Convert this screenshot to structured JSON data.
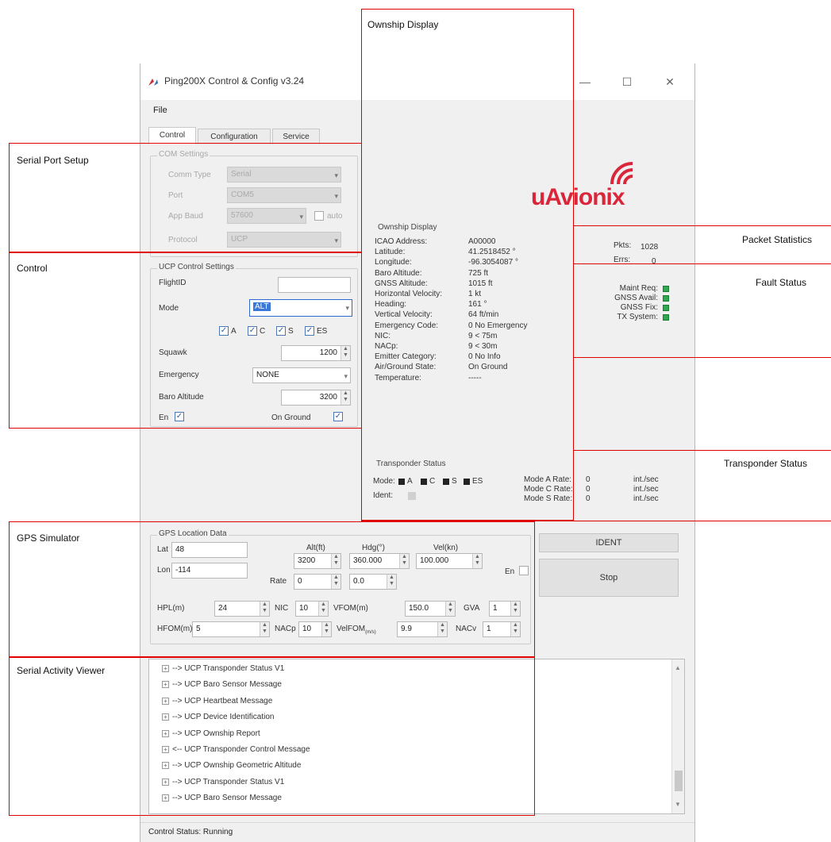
{
  "window": {
    "title": "Ping200X Control & Config v3.24",
    "minimize": "—",
    "maximize": "☐",
    "close": "✕",
    "menu_file": "File",
    "tabs": [
      "Control",
      "Configuration",
      "Service"
    ],
    "status_bar": "Control Status:  Running"
  },
  "com_settings": {
    "title": "COM Settings",
    "comm_type_label": "Comm Type",
    "comm_type_value": "Serial",
    "port_label": "Port",
    "port_value": "COM5",
    "app_baud_label": "App Baud",
    "app_baud_value": "57600",
    "auto_label": "auto",
    "protocol_label": "Protocol",
    "protocol_value": "UCP"
  },
  "ucp_control": {
    "title": "UCP Control Settings",
    "flight_id_label": "FlightID",
    "flight_id_value": "",
    "mode_label": "Mode",
    "mode_value": "ALT",
    "mode_checks": [
      "A",
      "C",
      "S",
      "ES"
    ],
    "squawk_label": "Squawk",
    "squawk_value": "1200",
    "emergency_label": "Emergency",
    "emergency_value": "NONE",
    "baro_label": "Baro Altitude",
    "baro_value": "3200",
    "en_label": "En",
    "on_ground_label": "On Ground"
  },
  "logo_text": "uAvionix",
  "ownship": {
    "title": "Ownship Display",
    "rows": [
      {
        "label": "ICAO Address:",
        "value": "A00000"
      },
      {
        "label": "Latitude:",
        "value": "41.2518452 °"
      },
      {
        "label": "Longitude:",
        "value": "-96.3054087 °"
      },
      {
        "label": "Baro Altitude:",
        "value": "725 ft"
      },
      {
        "label": "GNSS Altitude:",
        "value": "1015 ft"
      },
      {
        "label": "Horizontal Velocity:",
        "value": "1 kt"
      },
      {
        "label": "Heading:",
        "value": "161 °"
      },
      {
        "label": "Vertical Velocity:",
        "value": "64 ft/min"
      },
      {
        "label": "Emergency Code:",
        "value": "0   No Emergency"
      },
      {
        "label": "NIC:",
        "value": "9   < 75m"
      },
      {
        "label": "NACp:",
        "value": "9   < 30m"
      },
      {
        "label": "Emitter Category:",
        "value": "0   No Info"
      },
      {
        "label": "Air/Ground State:",
        "value": "On Ground"
      },
      {
        "label": "Temperature:",
        "value": "-----"
      }
    ]
  },
  "packets": {
    "pkts_label": "Pkts:",
    "pkts_value": "1028",
    "errs_label": "Errs:",
    "errs_value": "0"
  },
  "faults": [
    "Maint Req:",
    "GNSS Avail:",
    "GNSS Fix:",
    "TX System:"
  ],
  "transponder": {
    "title": "Transponder Status",
    "mode_label": "Mode:",
    "modes": [
      "A",
      "C",
      "S",
      "ES"
    ],
    "ident_label": "Ident:",
    "rates": [
      {
        "label": "Mode A Rate:",
        "value": "0",
        "unit": "int./sec"
      },
      {
        "label": "Mode C Rate:",
        "value": "0",
        "unit": "int./sec"
      },
      {
        "label": "Mode S Rate:",
        "value": "0",
        "unit": "int./sec"
      }
    ]
  },
  "gps": {
    "title": "GPS Location Data",
    "lat_label": "Lat",
    "lat_value": "48",
    "lon_label": "Lon",
    "lon_value": "-114",
    "alt_label": "Alt(ft)",
    "alt_value": "3200",
    "hdg_label": "Hdg(°)",
    "hdg_value": "360.000",
    "vel_label": "Vel(kn)",
    "vel_value": "100.000",
    "rate_label": "Rate",
    "rate1_value": "0",
    "rate2_value": "0.0",
    "en_label": "En",
    "hpl_label": "HPL(m)",
    "hpl_value": "24",
    "nic_label": "NIC",
    "nic_value": "10",
    "vfom_label": "VFOM(m)",
    "vfom_value": "150.0",
    "gva_label": "GVA",
    "gva_value": "1",
    "hfom_label": "HFOM(m)",
    "hfom_value": "5",
    "nacp_label": "NACp",
    "nacp_value": "10",
    "velfom_label": "VelFOM",
    "velfom_sub": "(m/s)",
    "velfom_value": "9.9",
    "nacv_label": "NACv",
    "nacv_value": "1"
  },
  "buttons": {
    "ident": "IDENT",
    "stop": "Stop"
  },
  "activity_log": [
    "--> UCP Transponder Status V1",
    "--> UCP Baro Sensor Message",
    "--> UCP Heartbeat Message",
    "--> UCP Device Identification",
    "--> UCP Ownship Report",
    "<-- UCP Transponder Control Message",
    "--> UCP Ownship Geometric Altitude",
    "--> UCP Transponder Status V1",
    "--> UCP Baro Sensor Message"
  ],
  "annotations": {
    "ownship_display": "Ownship Display",
    "serial_port_setup": "Serial Port Setup",
    "control": "Control",
    "packet_statistics": "Packet Statistics",
    "fault_status": "Fault Status",
    "transponder_status": "Transponder Status",
    "gps_simulator": "GPS Simulator",
    "serial_activity_viewer": "Serial Activity Viewer"
  },
  "colors": {
    "annotation": "#e00000",
    "led_on": "#2fa84f",
    "logo": "#d9263a"
  }
}
